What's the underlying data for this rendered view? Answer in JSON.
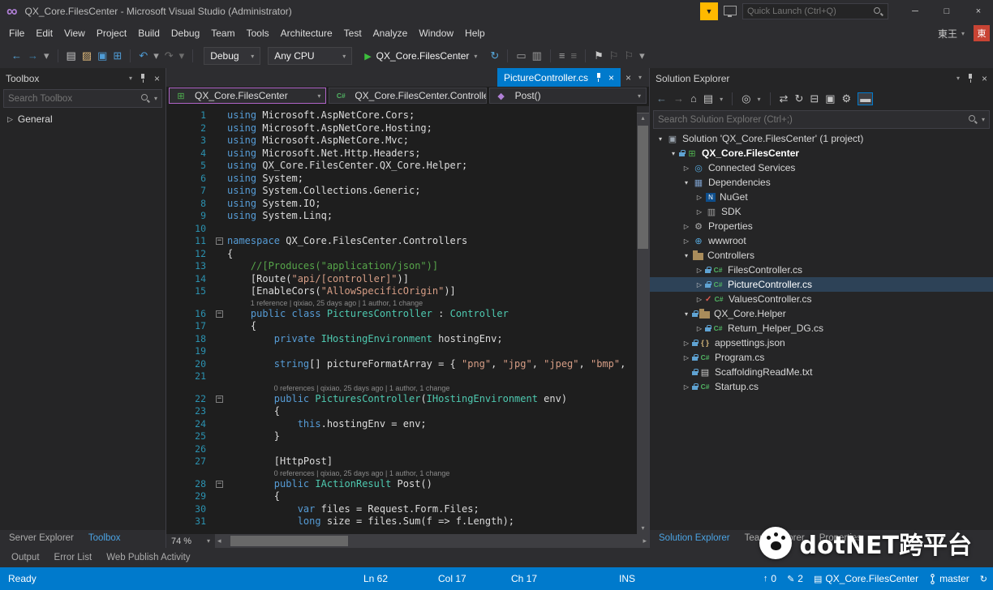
{
  "colors": {
    "accent": "#007ACC",
    "editor_bg": "#1E1E1E",
    "panel_bg": "#252526",
    "frame_bg": "#2D2D30",
    "status_bg": "#007ACC",
    "line_number": "#2B91AF",
    "selection_row": "#2D4257",
    "code": {
      "k": "#569CD6",
      "t": "#4EC9B0",
      "s": "#D69D85",
      "c": "#57A64A",
      "p": "#DCDCDC"
    }
  },
  "title_bar": {
    "app_title": "QX_Core.FilesCenter - Microsoft Visual Studio  (Administrator)",
    "quick_launch_placeholder": "Quick Launch (Ctrl+Q)"
  },
  "menu": {
    "items": [
      "File",
      "Edit",
      "View",
      "Project",
      "Build",
      "Debug",
      "Team",
      "Tools",
      "Architecture",
      "Test",
      "Analyze",
      "Window",
      "Help"
    ],
    "user_name": "東王",
    "user_badge": "東"
  },
  "toolbar": {
    "debug_config": "Debug",
    "platform": "Any CPU",
    "run_label": "QX_Core.FilesCenter",
    "left_icons": [
      {
        "name": "navigate-backward-icon",
        "glyph": "←",
        "color": "#56A8DC"
      },
      {
        "name": "navigate-forward-icon",
        "glyph": "→",
        "color": "#3E7FA8"
      },
      {
        "name": "navigation-caret-icon",
        "glyph": "▾",
        "color": "#9E9E9E"
      },
      {
        "name": "separator"
      },
      {
        "name": "new-project-icon",
        "glyph": "▤",
        "color": "#C8C8C8"
      },
      {
        "name": "open-file-icon",
        "glyph": "▨",
        "color": "#DCB67A"
      },
      {
        "name": "save-icon",
        "glyph": "▣",
        "color": "#4F9CD6"
      },
      {
        "name": "save-all-icon",
        "glyph": "⊞",
        "color": "#4F9CD6"
      },
      {
        "name": "separator"
      },
      {
        "name": "undo-icon",
        "glyph": "↶",
        "color": "#4F9CD6"
      },
      {
        "name": "undo-caret-icon",
        "glyph": "▾",
        "color": "#9E9E9E"
      },
      {
        "name": "redo-icon",
        "glyph": "↷",
        "color": "#6E6E6E"
      },
      {
        "name": "redo-caret-icon",
        "glyph": "▾",
        "color": "#6E6E6E"
      },
      {
        "name": "separator"
      }
    ],
    "right_icons": [
      {
        "name": "sync-with-active-icon",
        "glyph": "↻",
        "color": "#56A8DC"
      },
      {
        "name": "separator"
      },
      {
        "name": "navigate-to-icon",
        "glyph": "▭",
        "color": "#9E9E9E"
      },
      {
        "name": "find-in-files-icon",
        "glyph": "▥",
        "color": "#9E9E9E"
      },
      {
        "name": "separator"
      },
      {
        "name": "comment-out-icon",
        "glyph": "≡",
        "color": "#9E9E9E"
      },
      {
        "name": "uncomment-icon",
        "glyph": "≡",
        "color": "#6E6E6E"
      },
      {
        "name": "separator"
      },
      {
        "name": "toggle-bookmark-icon",
        "glyph": "⚑",
        "color": "#C8C8C8"
      },
      {
        "name": "previous-bookmark-icon",
        "glyph": "⚐",
        "color": "#6E6E6E"
      },
      {
        "name": "next-bookmark-icon",
        "glyph": "⚐",
        "color": "#6E6E6E"
      },
      {
        "name": "toolbar-overflow-caret-icon",
        "glyph": "▾",
        "color": "#9E9E9E"
      }
    ]
  },
  "toolbox": {
    "title": "Toolbox",
    "search_placeholder": "Search Toolbox",
    "items": [
      {
        "label": "General"
      }
    ],
    "tabs": [
      {
        "label": "Server Explorer",
        "active": false
      },
      {
        "label": "Toolbox",
        "active": true
      }
    ]
  },
  "editor": {
    "tab_label": "PictureController.cs",
    "nav": {
      "project": "QX_Core.FilesCenter",
      "type": "QX_Core.FilesCenter.Controlle",
      "member": "Post()"
    },
    "zoom": "74 %",
    "lines": [
      {
        "n": 1,
        "segs": [
          [
            "using",
            "k"
          ],
          [
            " Microsoft.AspNetCore.Cors;",
            "p"
          ]
        ]
      },
      {
        "n": 2,
        "segs": [
          [
            "using",
            "k"
          ],
          [
            " Microsoft.AspNetCore.Hosting;",
            "p"
          ]
        ]
      },
      {
        "n": 3,
        "segs": [
          [
            "using",
            "k"
          ],
          [
            " Microsoft.AspNetCore.Mvc;",
            "p"
          ]
        ]
      },
      {
        "n": 4,
        "segs": [
          [
            "using",
            "k"
          ],
          [
            " Microsoft.Net.Http.Headers;",
            "p"
          ]
        ]
      },
      {
        "n": 5,
        "segs": [
          [
            "using",
            "k"
          ],
          [
            " QX_Core.FilesCenter.QX_Core.Helper;",
            "p"
          ]
        ]
      },
      {
        "n": 6,
        "segs": [
          [
            "using",
            "k"
          ],
          [
            " System;",
            "p"
          ]
        ]
      },
      {
        "n": 7,
        "segs": [
          [
            "using",
            "k"
          ],
          [
            " System.Collections.Generic;",
            "p"
          ]
        ]
      },
      {
        "n": 8,
        "segs": [
          [
            "using",
            "k"
          ],
          [
            " System.IO;",
            "p"
          ]
        ]
      },
      {
        "n": 9,
        "segs": [
          [
            "using",
            "k"
          ],
          [
            " System.Linq;",
            "p"
          ]
        ]
      },
      {
        "n": 10,
        "segs": []
      },
      {
        "n": 11,
        "fold": true,
        "segs": [
          [
            "namespace",
            "k"
          ],
          [
            " QX_Core.FilesCenter.Controllers",
            "p"
          ]
        ]
      },
      {
        "n": 12,
        "segs": [
          [
            "{",
            "p"
          ]
        ]
      },
      {
        "n": 13,
        "segs": [
          [
            "    //[Produces(\"application/json\")]",
            "c"
          ]
        ]
      },
      {
        "n": 14,
        "segs": [
          [
            "    [Route(",
            "p"
          ],
          [
            "\"api/[controller]\"",
            "s"
          ],
          [
            ")]",
            "p"
          ]
        ]
      },
      {
        "n": 15,
        "segs": [
          [
            "    [EnableCors(",
            "p"
          ],
          [
            "\"AllowSpecificOrigin\"",
            "s"
          ],
          [
            ")]",
            "p"
          ]
        ]
      },
      {
        "n": 16,
        "fold": true,
        "lens": "1 reference | qixiao, 25 days ago | 1 author, 1 change",
        "segs": [
          [
            "    ",
            "p"
          ],
          [
            "public",
            "k"
          ],
          [
            " ",
            "p"
          ],
          [
            "class",
            "k"
          ],
          [
            " ",
            "p"
          ],
          [
            "PicturesController",
            "t"
          ],
          [
            " : ",
            "p"
          ],
          [
            "Controller",
            "t"
          ]
        ]
      },
      {
        "n": 17,
        "segs": [
          [
            "    {",
            "p"
          ]
        ]
      },
      {
        "n": 18,
        "segs": [
          [
            "        ",
            "p"
          ],
          [
            "private",
            "k"
          ],
          [
            " ",
            "p"
          ],
          [
            "IHostingEnvironment",
            "t"
          ],
          [
            " hostingEnv;",
            "p"
          ]
        ]
      },
      {
        "n": 19,
        "segs": []
      },
      {
        "n": 20,
        "segs": [
          [
            "        ",
            "p"
          ],
          [
            "string",
            "k"
          ],
          [
            "[] pictureFormatArray = { ",
            "p"
          ],
          [
            "\"png\"",
            "s"
          ],
          [
            ", ",
            "p"
          ],
          [
            "\"jpg\"",
            "s"
          ],
          [
            ", ",
            "p"
          ],
          [
            "\"jpeg\"",
            "s"
          ],
          [
            ", ",
            "p"
          ],
          [
            "\"bmp\"",
            "s"
          ],
          [
            ",",
            "p"
          ]
        ]
      },
      {
        "n": 21,
        "segs": []
      },
      {
        "n": 22,
        "fold": true,
        "lens": "0 references | qixiao, 25 days ago | 1 author, 1 change",
        "segs": [
          [
            "        ",
            "p"
          ],
          [
            "public",
            "k"
          ],
          [
            " ",
            "p"
          ],
          [
            "PicturesController",
            "t"
          ],
          [
            "(",
            "p"
          ],
          [
            "IHostingEnvironment",
            "t"
          ],
          [
            " env)",
            "p"
          ]
        ]
      },
      {
        "n": 23,
        "segs": [
          [
            "        {",
            "p"
          ]
        ]
      },
      {
        "n": 24,
        "segs": [
          [
            "            ",
            "p"
          ],
          [
            "this",
            "k"
          ],
          [
            ".hostingEnv = env;",
            "p"
          ]
        ]
      },
      {
        "n": 25,
        "segs": [
          [
            "        }",
            "p"
          ]
        ]
      },
      {
        "n": 26,
        "segs": []
      },
      {
        "n": 27,
        "segs": [
          [
            "        [HttpPost]",
            "p"
          ]
        ]
      },
      {
        "n": 28,
        "fold": true,
        "lens": "0 references | qixiao, 25 days ago | 1 author, 1 change",
        "segs": [
          [
            "        ",
            "p"
          ],
          [
            "public",
            "k"
          ],
          [
            " ",
            "p"
          ],
          [
            "IActionResult",
            "t"
          ],
          [
            " Post()",
            "p"
          ]
        ]
      },
      {
        "n": 29,
        "segs": [
          [
            "        {",
            "p"
          ]
        ]
      },
      {
        "n": 30,
        "segs": [
          [
            "            ",
            "p"
          ],
          [
            "var",
            "k"
          ],
          [
            " files = Request.Form.Files;",
            "p"
          ]
        ]
      },
      {
        "n": 31,
        "segs": [
          [
            "            ",
            "p"
          ],
          [
            "long",
            "k"
          ],
          [
            " size = files.Sum(f => f.Length);",
            "p"
          ]
        ]
      }
    ]
  },
  "solution_explorer": {
    "title": "Solution Explorer",
    "search_placeholder": "Search Solution Explorer (Ctrl+;)",
    "toolbar_icons": [
      {
        "name": "se-back-icon",
        "glyph": "←",
        "color": "#6E8CA0"
      },
      {
        "name": "se-forward-icon",
        "glyph": "→",
        "color": "#6E6E6E"
      },
      {
        "name": "se-home-icon",
        "glyph": "⌂",
        "color": "#C8C8C8"
      },
      {
        "name": "se-switch-views-icon",
        "glyph": "▤",
        "color": "#C8C8C8",
        "caret": true
      },
      {
        "name": "separator"
      },
      {
        "name": "se-pending-changes-filter-icon",
        "glyph": "◎",
        "color": "#C8C8C8",
        "caret": true
      },
      {
        "name": "separator"
      },
      {
        "name": "se-sync-active-document-icon",
        "glyph": "⇄",
        "color": "#C8C8C8"
      },
      {
        "name": "se-refresh-icon",
        "glyph": "↻",
        "color": "#C8C8C8"
      },
      {
        "name": "se-collapse-all-icon",
        "glyph": "⊟",
        "color": "#C8C8C8"
      },
      {
        "name": "se-show-all-files-icon",
        "glyph": "▣",
        "color": "#C8C8C8"
      },
      {
        "name": "se-properties-icon",
        "glyph": "⚙",
        "color": "#C8C8C8"
      },
      {
        "name": "se-preview-selected-items-icon",
        "glyph": "▬",
        "color": "#C8C8C8",
        "active": true
      }
    ],
    "tree": [
      {
        "label": "Solution 'QX_Core.FilesCenter' (1 project)",
        "lvl": 0,
        "arrow": "e",
        "icon": "solution"
      },
      {
        "label": "QX_Core.FilesCenter",
        "lvl": 1,
        "arrow": "e",
        "icon": "project",
        "bold": true,
        "lock": true
      },
      {
        "label": "Connected Services",
        "lvl": 2,
        "arrow": "c",
        "icon": "services"
      },
      {
        "label": "Dependencies",
        "lvl": 2,
        "arrow": "e",
        "icon": "deps"
      },
      {
        "label": "NuGet",
        "lvl": 3,
        "arrow": "c",
        "icon": "nuget"
      },
      {
        "label": "SDK",
        "lvl": 3,
        "arrow": "c",
        "icon": "sdk"
      },
      {
        "label": "Properties",
        "lvl": 2,
        "arrow": "c",
        "icon": "wrench"
      },
      {
        "label": "wwwroot",
        "lvl": 2,
        "arrow": "c",
        "icon": "globe"
      },
      {
        "label": "Controllers",
        "lvl": 2,
        "arrow": "e",
        "icon": "folder"
      },
      {
        "label": "FilesController.cs",
        "lvl": 3,
        "arrow": "c",
        "icon": "cs",
        "lock": true
      },
      {
        "label": "PictureController.cs",
        "lvl": 3,
        "arrow": "c",
        "icon": "cs",
        "lock": true,
        "sel": true
      },
      {
        "label": "ValuesController.cs",
        "lvl": 3,
        "arrow": "c",
        "icon": "cs",
        "check": true
      },
      {
        "label": "QX_Core.Helper",
        "lvl": 2,
        "arrow": "e",
        "icon": "folder",
        "lock": true
      },
      {
        "label": "Return_Helper_DG.cs",
        "lvl": 3,
        "arrow": "c",
        "icon": "cs",
        "lock": true
      },
      {
        "label": "appsettings.json",
        "lvl": 2,
        "arrow": "c",
        "icon": "json",
        "lock": true
      },
      {
        "label": "Program.cs",
        "lvl": 2,
        "arrow": "c",
        "icon": "cs",
        "lock": true
      },
      {
        "label": "ScaffoldingReadMe.txt",
        "lvl": 2,
        "icon": "txt",
        "lock": true
      },
      {
        "label": "Startup.cs",
        "lvl": 2,
        "arrow": "c",
        "icon": "cs",
        "lock": true
      }
    ],
    "tabs": [
      {
        "label": "Solution Explorer",
        "active": true
      },
      {
        "label": "Team Explorer",
        "active": false
      },
      {
        "label": "Properties",
        "active": false
      }
    ]
  },
  "bottom_panel": {
    "tabs": [
      "Output",
      "Error List",
      "Web Publish Activity"
    ]
  },
  "status_bar": {
    "ready": "Ready",
    "line": "Ln 62",
    "column": "Col 17",
    "character": "Ch 17",
    "mode": "INS",
    "outgoing": "0",
    "edits": "2",
    "repo": "QX_Core.FilesCenter",
    "branch": "master"
  },
  "watermark": {
    "text": "dotNET跨平台"
  }
}
